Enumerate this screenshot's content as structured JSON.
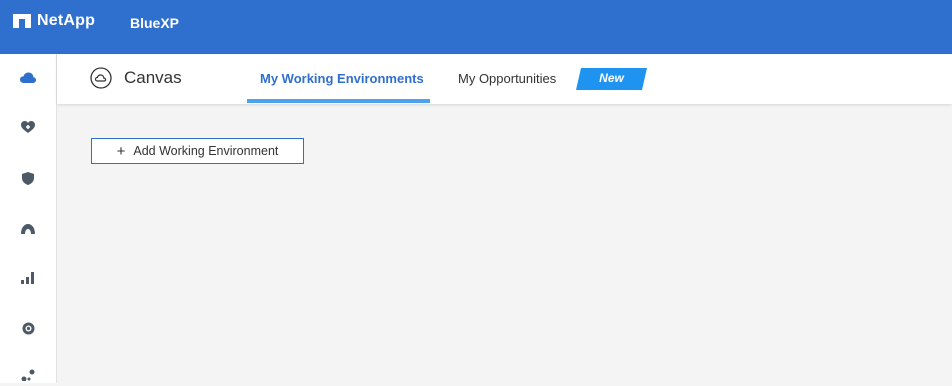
{
  "header": {
    "brand": "NetApp",
    "product": "BlueXP",
    "color": "#2f6fcd"
  },
  "sidebar": {
    "icons": [
      "cloud-icon",
      "heart-shield-icon",
      "shield-icon",
      "dome-icon",
      "bar-signal-icon",
      "circle-sync-icon",
      "nodes-icon"
    ],
    "active": "cloud-icon"
  },
  "tabbar": {
    "title": "Canvas",
    "tabs": [
      {
        "label": "My Working Environments",
        "active": true
      },
      {
        "label": "My Opportunities",
        "active": false
      }
    ],
    "badge": "New",
    "accent": "#4aa3ec"
  },
  "main": {
    "add_button_label": "Add Working Environment"
  }
}
